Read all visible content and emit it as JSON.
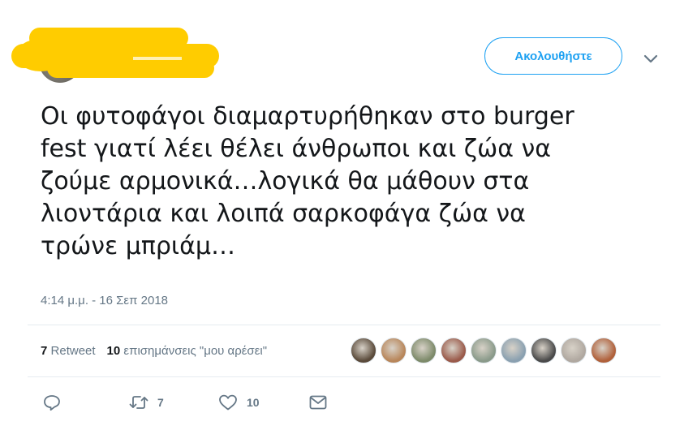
{
  "header": {
    "follow_label": "Ακολουθήστε",
    "caret_icon": "chevron-down-icon"
  },
  "tweet": {
    "text": "Οι φυτοφάγοι διαμαρτυρήθηκαν στο burger\nfest γιατί λέει θέλει άνθρωποι και ζώα να\nζούμε αρμονικά…λογικά θα μάθουν στα\nλιοντάρια και λοιπά σαρκοφάγα ζώα να\nτρώνε μπριάμ…",
    "timestamp": "4:14 μ.μ. - 16 Σεπ 2018"
  },
  "stats": {
    "retweets_count": "7",
    "retweets_label": "Retweet",
    "likes_count": "10",
    "likes_label": "επισημάνσεις \"μου αρέσει\""
  },
  "likers": [
    {
      "name": "liker-avatar-1",
      "color": "#5a4a3a"
    },
    {
      "name": "liker-avatar-2",
      "color": "#b8865a"
    },
    {
      "name": "liker-avatar-3",
      "color": "#7d8a6a"
    },
    {
      "name": "liker-avatar-4",
      "color": "#9a5a4a"
    },
    {
      "name": "liker-avatar-5",
      "color": "#8a9a8a"
    },
    {
      "name": "liker-avatar-6",
      "color": "#8aa0b0"
    },
    {
      "name": "liker-avatar-7",
      "color": "#4a4a4a"
    },
    {
      "name": "liker-avatar-8",
      "color": "#b0a8a0"
    },
    {
      "name": "liker-avatar-9",
      "color": "#b0603a"
    }
  ],
  "actions": {
    "reply_icon": "reply-icon",
    "retweet_icon": "retweet-icon",
    "retweet_count": "7",
    "like_icon": "heart-icon",
    "like_count": "10",
    "dm_icon": "envelope-icon"
  },
  "colors": {
    "accent": "#1da1f2",
    "muted": "#657786",
    "text": "#14171a",
    "redaction": "#ffcc00"
  }
}
